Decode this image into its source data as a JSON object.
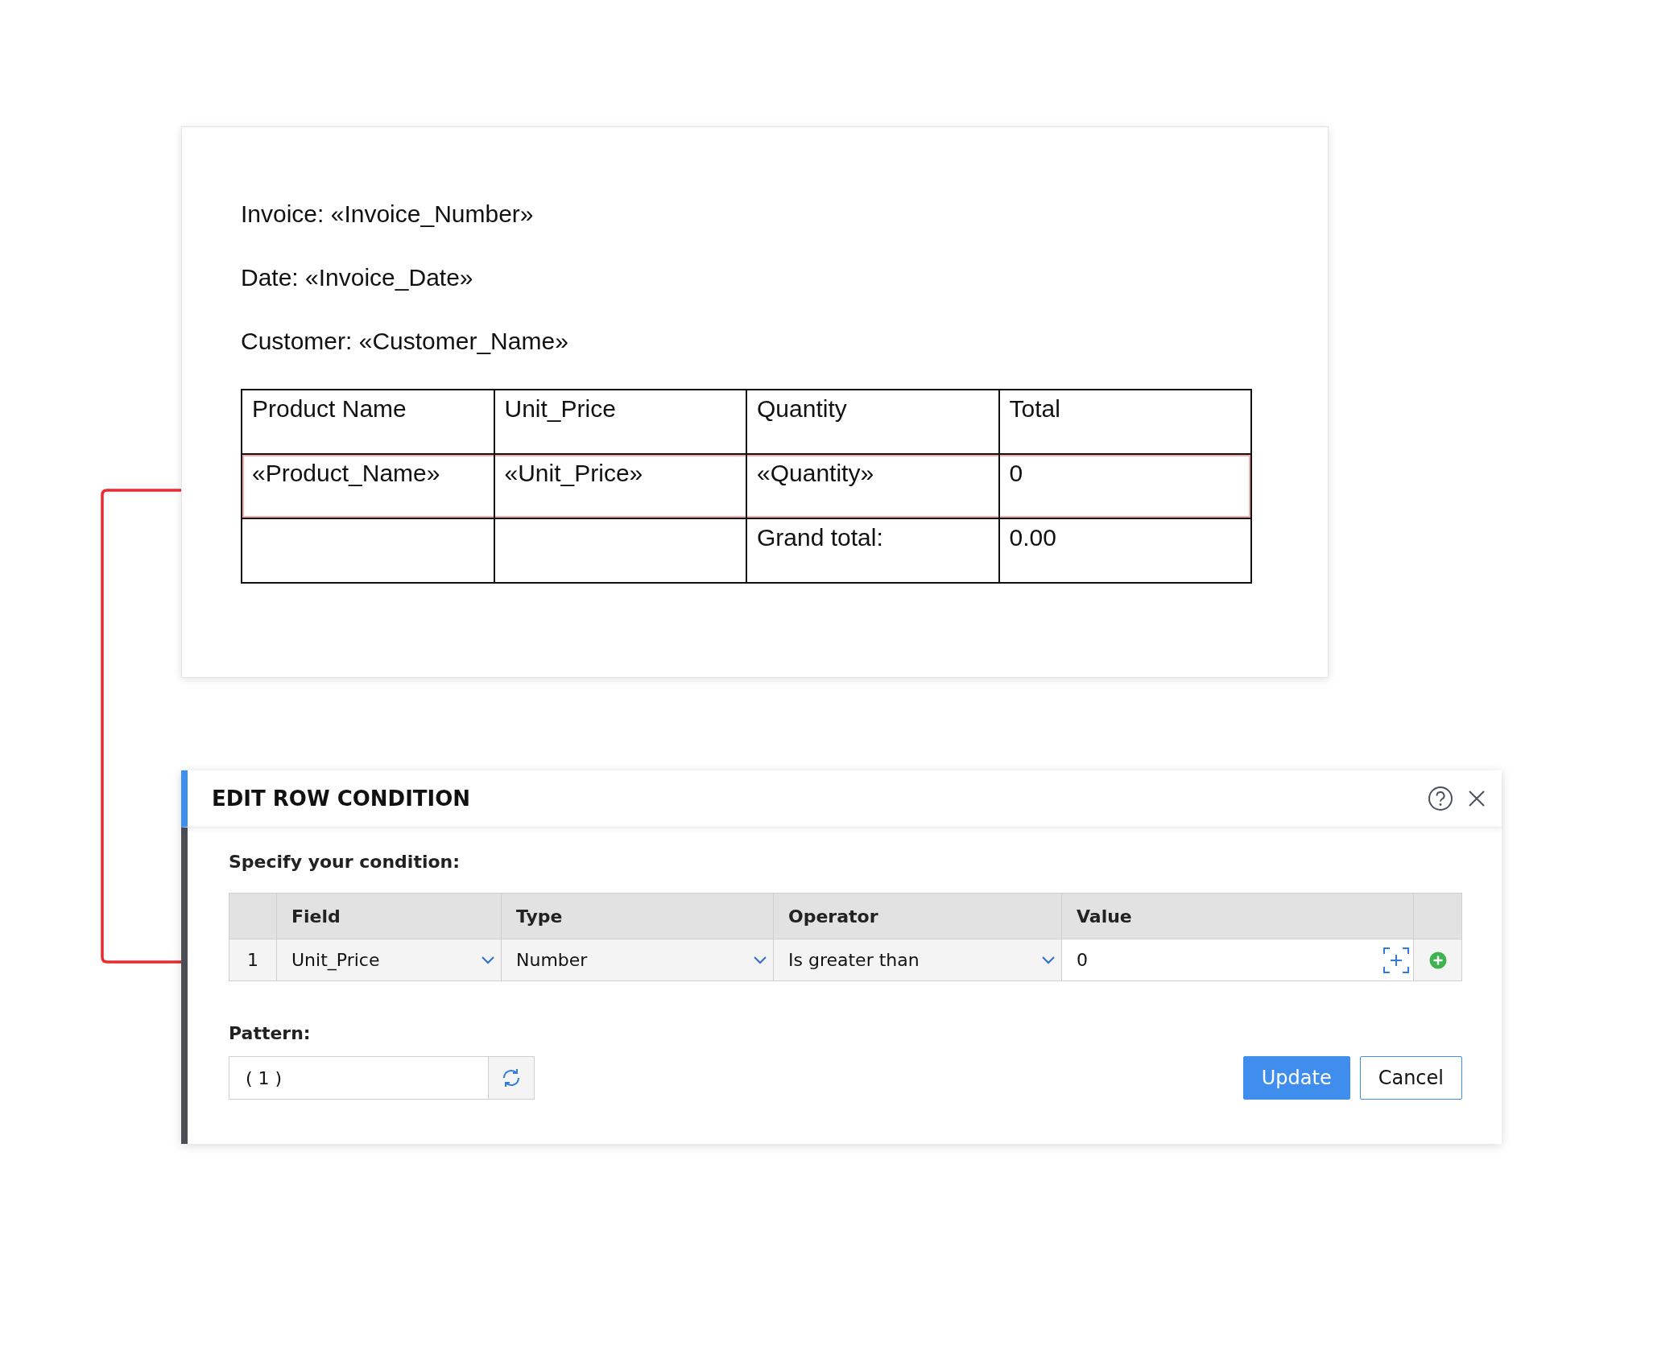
{
  "document": {
    "lines": [
      "Invoice: «Invoice_Number»",
      "Date: «Invoice_Date»",
      "Customer: «Customer_Name»"
    ],
    "table": {
      "columns": [
        "Product Name",
        "Unit_Price",
        "Quantity",
        "Total"
      ],
      "rows": [
        {
          "cells": [
            "«Product_Name»",
            "«Unit_Price»",
            "«Quantity»",
            "0"
          ],
          "highlighted": true
        },
        {
          "cells": [
            "",
            "",
            "Grand total:",
            "0.00"
          ],
          "highlighted": false
        }
      ]
    }
  },
  "dialog": {
    "title": "EDIT ROW CONDITION",
    "prompt": "Specify your condition:",
    "columns": [
      "Field",
      "Type",
      "Operator",
      "Value"
    ],
    "conditions": [
      {
        "index": "1",
        "field": "Unit_Price",
        "type": "Number",
        "operator": "Is greater than",
        "value": "0"
      }
    ],
    "pattern_label": "Pattern:",
    "pattern": "( 1 )",
    "buttons": [
      {
        "label": "Update",
        "kind": "primary"
      },
      {
        "label": "Cancel",
        "kind": "secondary"
      }
    ]
  }
}
